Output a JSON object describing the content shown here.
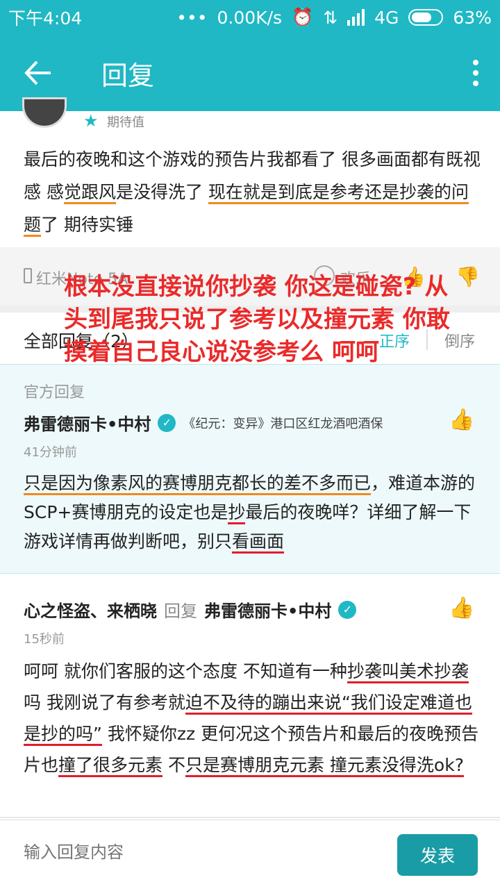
{
  "status_bar": {
    "time": "下午4:04",
    "dots": "•••",
    "speed": "0.00K/s",
    "network": "4G",
    "battery": "63%"
  },
  "app_bar": {
    "title": "回复"
  },
  "post": {
    "author_tag": "期待值",
    "text_parts": [
      "最后的夜晚和这个游戏的预告片我都看了 很多画面都有既视感 感",
      "觉跟风",
      "是没得洗了 ",
      "现在就是到底是参考",
      "还是抄袭的问题",
      "了 期待实锤"
    ],
    "device": "红米Note 5A",
    "emoji_label": "欢乐"
  },
  "replies": {
    "title": "全部回复（2）",
    "sort_asc": "正序",
    "sort_desc": "倒序"
  },
  "official_reply": {
    "label": "官方回复",
    "author": "弗雷德丽卡•中村",
    "role": "《纪元：变异》港口区红龙酒吧酒保",
    "time": "41分钟前",
    "text_parts": [
      "只是因为像素风的赛博朋克都长的差不多而已",
      "，难道本游的SCP+赛博朋克的设定也是",
      "抄",
      "最后的夜晚咩？详细了解一下游戏详情再做判断吧，别只",
      "看画面"
    ]
  },
  "user_reply": {
    "author": "心之怪盗、来栖晓",
    "reply_word": "回复",
    "reply_to": "弗雷德丽卡•中村",
    "time": "15秒前",
    "text_parts": [
      "呵呵 就你们客服的这个态度 不知道有一种",
      "抄袭叫美术抄袭",
      "吗 我刚说了有参考就",
      "迫不及待的蹦出来说“我们设定难道也是抄的吗”",
      " 我怀疑你zz 更何况这个预告片和最后的夜晚预告片也",
      "撞了很多元素",
      " 不",
      "只是赛博朋克元素 撞元素没得洗ok?"
    ]
  },
  "overlay": {
    "text": "根本没直接说你抄袭 你这是碰瓷? 从头到尾我只说了参考以及撞元素 你敢摸着自己良心说没参考么 呵呵"
  },
  "input_bar": {
    "placeholder": "输入回复内容",
    "send_label": "发表"
  }
}
